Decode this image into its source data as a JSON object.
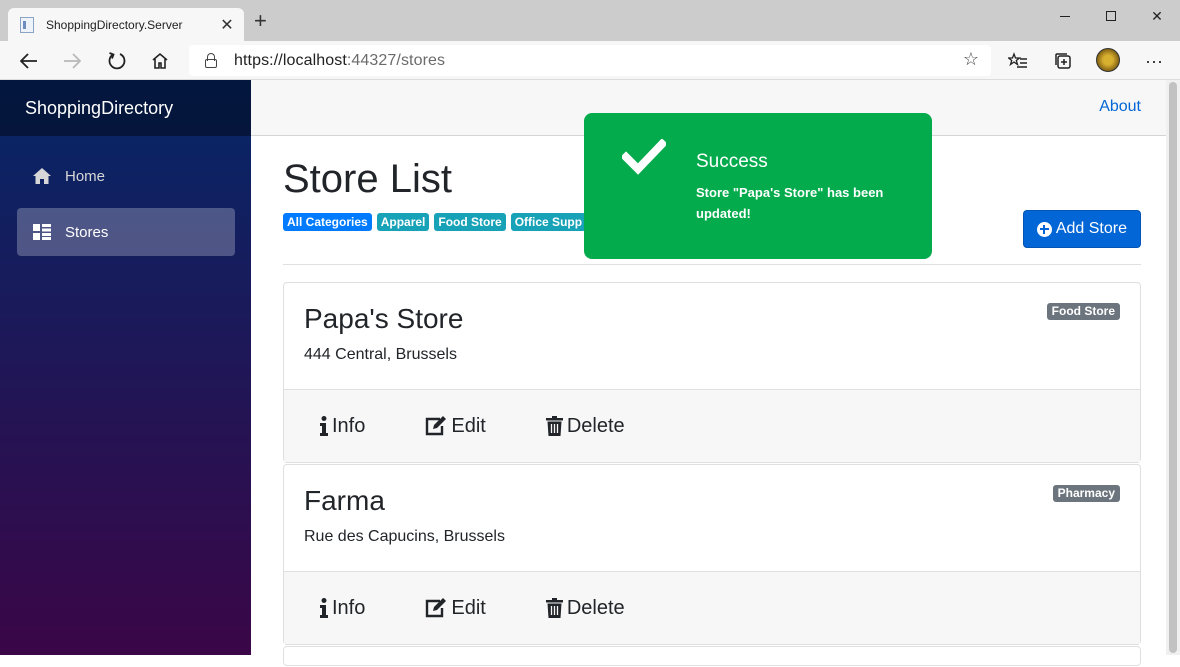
{
  "browser": {
    "tab_title": "ShoppingDirectory.Server",
    "url_host": "https://localhost",
    "url_rest": ":44327/stores"
  },
  "sidebar": {
    "brand": "ShoppingDirectory",
    "items": [
      {
        "label": "Home",
        "icon": "home-icon",
        "active": false
      },
      {
        "label": "Stores",
        "icon": "list-icon",
        "active": true
      }
    ]
  },
  "topbar": {
    "about": "About"
  },
  "page": {
    "title": "Store List",
    "categories": [
      "All Categories",
      "Apparel",
      "Food Store",
      "Office Supp"
    ],
    "add_button": "Add Store"
  },
  "stores": [
    {
      "name": "Papa's Store",
      "address": "444 Central,  Brussels",
      "category": "Food Store"
    },
    {
      "name": "Farma",
      "address": "Rue des Capucins,  Brussels",
      "category": "Pharmacy"
    }
  ],
  "actions": {
    "info": "Info",
    "edit": "Edit",
    "delete": "Delete"
  },
  "toast": {
    "title": "Success",
    "message": "Store \"Papa's Store\" has been updated!",
    "color": "#04ab4d"
  },
  "colors": {
    "primary": "#0366d6",
    "category_all": "#007bff",
    "category_other": "#17a2b8",
    "badge": "#6c757d"
  }
}
